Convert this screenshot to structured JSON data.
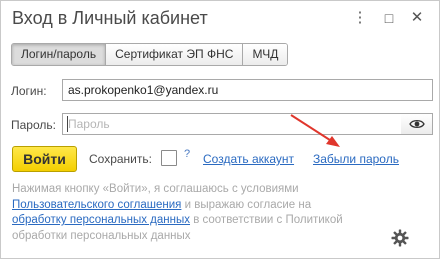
{
  "window": {
    "title": "Вход в Личный кабинет",
    "controls": {
      "more": "⋮",
      "maximize": "□",
      "close": "✕"
    }
  },
  "tabs": [
    {
      "label": "Логин/пароль",
      "active": true
    },
    {
      "label": "Сертификат ЭП ФНС",
      "active": false
    },
    {
      "label": "МЧД",
      "active": false
    }
  ],
  "form": {
    "login_label": "Логин:",
    "login_value": "as.prokopenko1@yandex.ru",
    "password_label": "Пароль:",
    "password_placeholder": "Пароль",
    "show_password_icon": "eye-icon",
    "enter_label": "Войти",
    "save_label": "Сохранить:",
    "save_checked": false,
    "help_mark": "?",
    "create_account_link": "Создать аккаунт",
    "forgot_password_link": "Забыли пароль"
  },
  "notice": {
    "part1": "Нажимая кнопку «Войти», я соглашаюсь с условиями",
    "agreement_link": "Пользовательского соглашения",
    "part2": " и выражаю согласие на",
    "processing_link": "обработку персональных данных",
    "part3": " в соответствии с Политикой",
    "part4": "обработки персональных данных"
  },
  "colors": {
    "accent_button": "#f4cf00",
    "link": "#2a6ac1",
    "arrow": "#e0362c",
    "muted_text": "#a9a9a9"
  },
  "icons": {
    "settings": "gear-icon",
    "annotation": "red-arrow"
  }
}
